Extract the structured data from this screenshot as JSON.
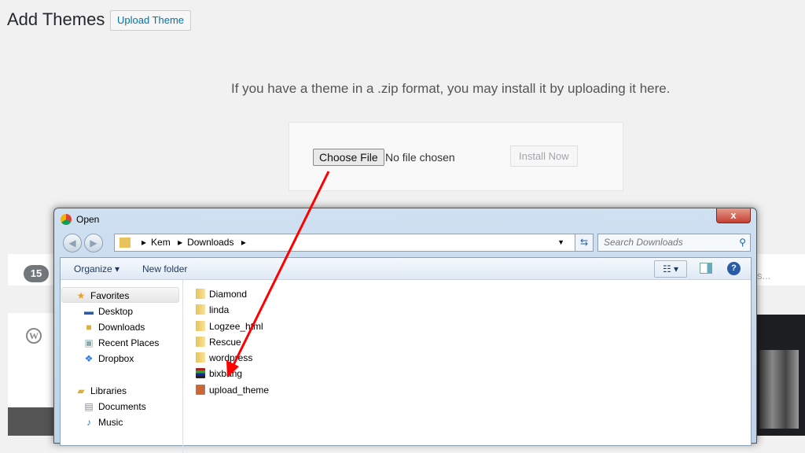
{
  "page": {
    "title": "Add Themes",
    "upload_button": "Upload Theme",
    "description": "If you have a theme in a .zip format, you may install it by uploading it here.",
    "choose_file": "Choose File",
    "no_file": "No file chosen",
    "install_now": "Install Now",
    "theme_count": "15",
    "search_hint": "s..."
  },
  "dialog": {
    "title": "Open",
    "close": "x",
    "path": [
      "Kem",
      "Downloads"
    ],
    "search_placeholder": "Search Downloads",
    "organize": "Organize ▾",
    "new_folder": "New folder",
    "nav": [
      {
        "label": "Favorites",
        "icon": "star-icon"
      },
      {
        "label": "Desktop",
        "icon": "desktop-icon"
      },
      {
        "label": "Downloads",
        "icon": "downloads-icon"
      },
      {
        "label": "Recent Places",
        "icon": "recent-places-icon"
      },
      {
        "label": "Dropbox",
        "icon": "dropbox-icon"
      },
      {
        "label": "Libraries",
        "icon": "libraries-icon"
      },
      {
        "label": "Documents",
        "icon": "documents-icon"
      },
      {
        "label": "Music",
        "icon": "music-icon"
      }
    ],
    "files": [
      {
        "name": "Diamond",
        "type": "folder"
      },
      {
        "name": "linda",
        "type": "folder"
      },
      {
        "name": "Logzee_html",
        "type": "folder"
      },
      {
        "name": "Rescue",
        "type": "folder"
      },
      {
        "name": "wordpress",
        "type": "folder"
      },
      {
        "name": "bixbang",
        "type": "rar"
      },
      {
        "name": "upload_theme",
        "type": "image"
      }
    ]
  },
  "annotation": {
    "arrow_color": "#ff0000"
  }
}
